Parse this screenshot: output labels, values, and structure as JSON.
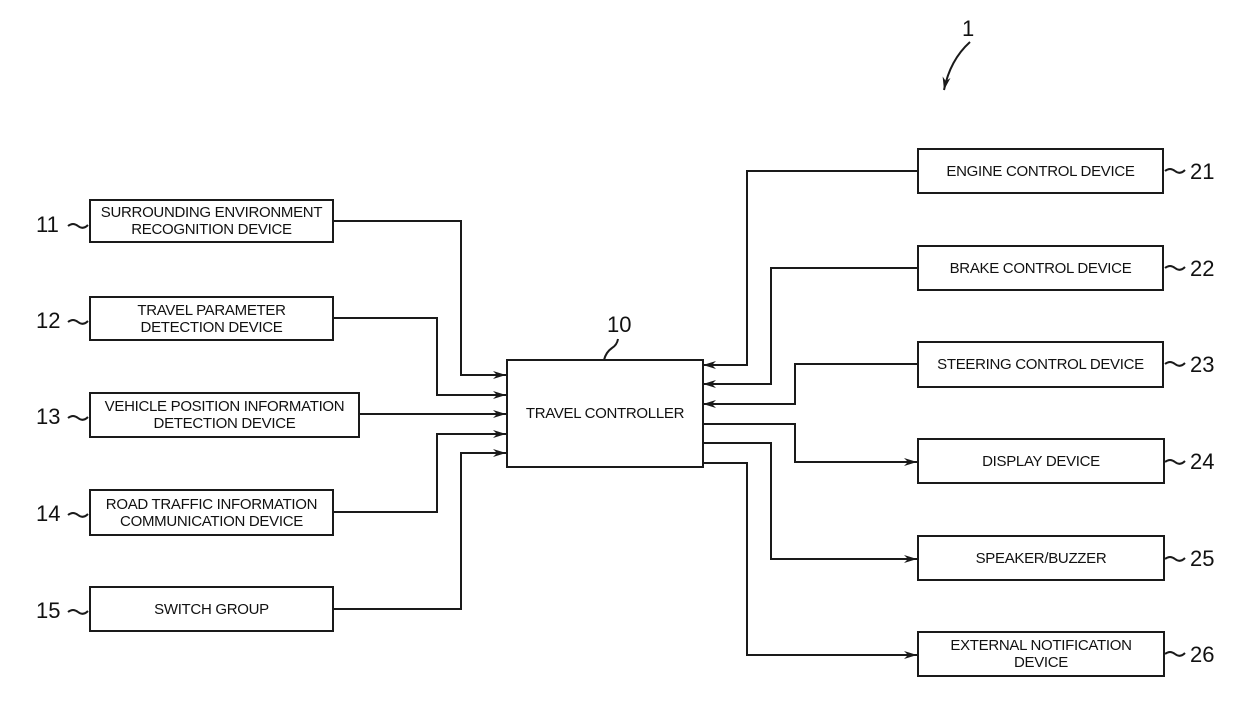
{
  "figure_ref": "1",
  "controller": {
    "ref": "10",
    "label": "TRAVEL CONTROLLER"
  },
  "inputs": [
    {
      "ref": "11",
      "label": "SURROUNDING ENVIRONMENT\nRECOGNITION DEVICE"
    },
    {
      "ref": "12",
      "label": "TRAVEL PARAMETER\nDETECTION DEVICE"
    },
    {
      "ref": "13",
      "label": "VEHICLE POSITION INFORMATION\nDETECTION DEVICE"
    },
    {
      "ref": "14",
      "label": "ROAD TRAFFIC INFORMATION\nCOMMUNICATION DEVICE"
    },
    {
      "ref": "15",
      "label": "SWITCH GROUP"
    }
  ],
  "outputs": [
    {
      "ref": "21",
      "label": "ENGINE CONTROL DEVICE",
      "direction": "to-controller"
    },
    {
      "ref": "22",
      "label": "BRAKE CONTROL DEVICE",
      "direction": "to-controller"
    },
    {
      "ref": "23",
      "label": "STEERING CONTROL DEVICE",
      "direction": "to-controller"
    },
    {
      "ref": "24",
      "label": "DISPLAY DEVICE",
      "direction": "from-controller"
    },
    {
      "ref": "25",
      "label": "SPEAKER/BUZZER",
      "direction": "from-controller"
    },
    {
      "ref": "26",
      "label": "EXTERNAL NOTIFICATION\nDEVICE",
      "direction": "from-controller"
    }
  ]
}
